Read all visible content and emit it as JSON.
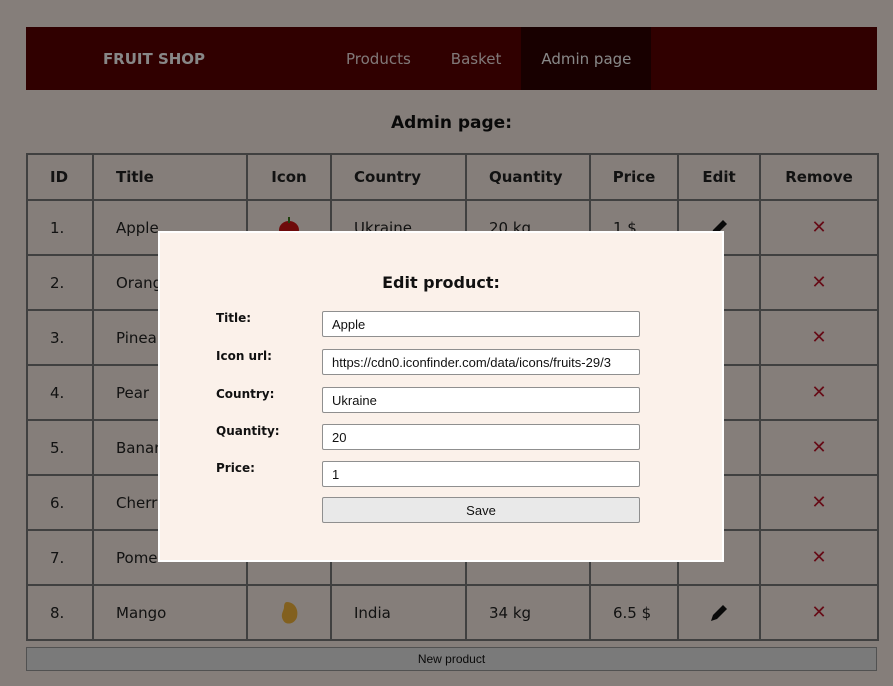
{
  "nav": {
    "brand": "FRUIT SHOP",
    "links": [
      "Products",
      "Basket",
      "Admin page"
    ],
    "active": "Admin page"
  },
  "page_title": "Admin page:",
  "table": {
    "headers": [
      "ID",
      "Title",
      "Icon",
      "Country",
      "Quantity",
      "Price",
      "Edit",
      "Remove"
    ],
    "rows": [
      {
        "id": "1.",
        "title": "Apple",
        "icon": "apple-icon",
        "country": "Ukraine",
        "quantity": "20 kg",
        "price": "1 $"
      },
      {
        "id": "2.",
        "title": "Orang"
      },
      {
        "id": "3.",
        "title": "Pinea"
      },
      {
        "id": "4.",
        "title": "Pear"
      },
      {
        "id": "5.",
        "title": "Banar"
      },
      {
        "id": "6.",
        "title": "Cherr"
      },
      {
        "id": "7.",
        "title": "Pome"
      },
      {
        "id": "8.",
        "title": "Mango",
        "icon": "mango-icon",
        "country": "India",
        "quantity": "34 kg",
        "price": "6.5 $"
      }
    ],
    "remove_symbol": "✕"
  },
  "new_product_label": "New product",
  "modal": {
    "title": "Edit product:",
    "labels": {
      "title": "Title:",
      "icon_url": "Icon url:",
      "country": "Country:",
      "quantity": "Quantity:",
      "price": "Price:"
    },
    "values": {
      "title": "Apple",
      "icon_url": "https://cdn0.iconfinder.com/data/icons/fruits-29/3",
      "country": "Ukraine",
      "quantity": "20",
      "price": "1"
    },
    "save_label": "Save"
  },
  "colors": {
    "nav_bg": "#5c0000",
    "nav_active": "#2f0000",
    "page_bg": "#fbefe6",
    "remove_red": "#c0152a"
  }
}
